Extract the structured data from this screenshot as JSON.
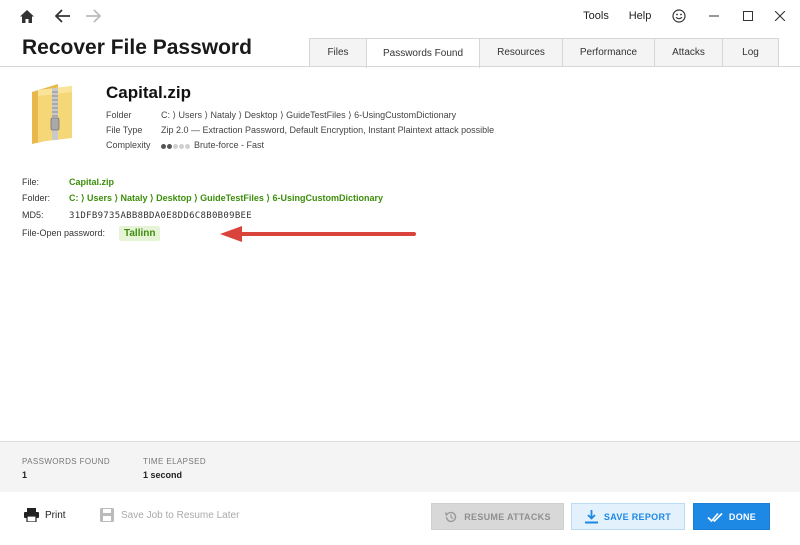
{
  "titlebar": {
    "menu_tools": "Tools",
    "menu_help": "Help"
  },
  "app": {
    "title": "Recover File Password"
  },
  "tabs": [
    {
      "label": "Files"
    },
    {
      "label": "Passwords Found"
    },
    {
      "label": "Resources"
    },
    {
      "label": "Performance"
    },
    {
      "label": "Attacks"
    },
    {
      "label": "Log"
    }
  ],
  "file_info": {
    "name": "Capital.zip",
    "folder_label": "Folder",
    "folder_value": "C: ⟩ Users ⟩ Nataly ⟩ Desktop ⟩ GuideTestFiles ⟩ 6-UsingCustomDictionary",
    "type_label": "File Type",
    "type_value": "Zip 2.0 — Extraction Password, Default Encryption, Instant Plaintext attack possible",
    "complexity_label": "Complexity",
    "complexity_value": "Brute-force - Fast",
    "complexity_level": 2,
    "complexity_max": 5
  },
  "results": {
    "file_label": "File:",
    "file_value": "Capital.zip",
    "folder_label": "Folder:",
    "folder_value": "C: ⟩ Users ⟩ Nataly ⟩ Desktop ⟩ GuideTestFiles ⟩ 6-UsingCustomDictionary",
    "md5_label": "MD5:",
    "md5_value": "31DFB9735ABB8BDA0E8DD6C8B0B09BEE",
    "password_label": "File-Open password:",
    "password_value": "Tallinn"
  },
  "stats": {
    "found_label": "PASSWORDS FOUND",
    "found_value": "1",
    "elapsed_label": "TIME ELAPSED",
    "elapsed_value": "1 second"
  },
  "footer": {
    "print_label": "Print",
    "save_job_label": "Save Job to Resume Later",
    "resume_label": "RESUME ATTACKS",
    "save_report_label": "SAVE REPORT",
    "done_label": "DONE"
  },
  "colors": {
    "accent": "#1e88e5",
    "green": "#3c8f0c",
    "arrow": "#d9433b"
  }
}
